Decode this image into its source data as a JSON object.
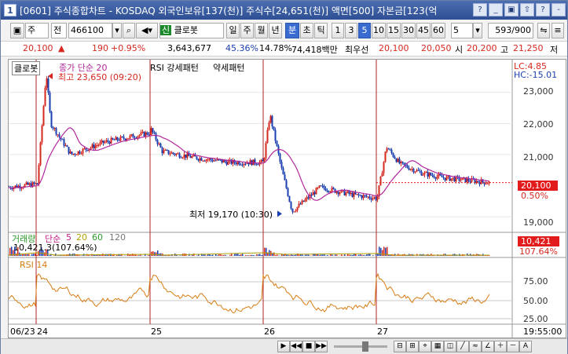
{
  "title": {
    "text": "[0601] 주식종합차트 - KOSDAQ 외국인보유[137(천)] 주식수[24,651(천)] 액면[500] 자본금[123(억",
    "icon": "1",
    "buttons": [
      "?",
      "_",
      "▣",
      "⇧",
      "?",
      "-"
    ]
  },
  "toolbar": {
    "mode": "주",
    "mode2": "전",
    "code": "466100",
    "name": "클로봇",
    "name_prefix": "신",
    "periods": [
      "일",
      "주",
      "월",
      "년",
      "분",
      "초",
      "틱"
    ],
    "active_period": "분",
    "intervals": [
      "1",
      "3",
      "5",
      "10",
      "15",
      "30",
      "45",
      "60"
    ],
    "active_interval": "5",
    "interval_select": "5",
    "page_count": "593/900"
  },
  "quote": {
    "price": "20,100",
    "change": "190",
    "change_pct": "+0.95%",
    "volume": "3,643,677",
    "vol_pct": "45.36%",
    "turnover": "14.78%",
    "amount": "74,418백만",
    "bid_label": "최우선",
    "bid": "20,100",
    "ask": "20,050",
    "open_label": "시",
    "open": "20,200",
    "high_label": "고",
    "high": "21,250",
    "low_label": "저"
  },
  "legend": {
    "name": "클로봇",
    "ma": "종가 단순 20",
    "rsi_pattern": "RSI 강세패턴",
    "rsi_weak": "약세패턴",
    "lc": "LC:4.85",
    "hc": "HC:-15.01",
    "vol_title": "거래량",
    "vol_ma_label": "단순",
    "vol_ma": [
      "5",
      "20",
      "60",
      "120"
    ],
    "vol_value": "10,421.3(107.64%)",
    "rsi_title": "RSI 14"
  },
  "annotations": {
    "max_label": "최고 23,650 (09:20)",
    "min_label": "최저 19,170 (10:30)"
  },
  "price_axis": [
    "23,000",
    "22,000",
    "21,000",
    "20,100",
    "0.50%",
    "19,000"
  ],
  "vol_axis": {
    "value": "10,421",
    "pct": "107.64%"
  },
  "rsi_axis": [
    "75.00",
    "50.00",
    "25.00"
  ],
  "time_axis": [
    "06/23",
    "24",
    "25",
    "26",
    "27"
  ],
  "clock": "19:55:00",
  "colors": {
    "up": "#d6281e",
    "down": "#1b3fb0",
    "ma": "#b0279c",
    "rsi": "#d87c12",
    "divider": "#b32020",
    "current": "#e21c1c"
  },
  "chart_data": {
    "type": "candlestick",
    "x_label": "5분봉",
    "y_range": [
      18700,
      23650
    ],
    "days": [
      {
        "date": "06/24",
        "open": 19900,
        "close": 21600,
        "high": 23650,
        "low": 19700
      },
      {
        "date": "06/25",
        "open": 21800,
        "close": 20550,
        "high": 21850,
        "low": 20450
      },
      {
        "date": "06/26",
        "open": 20800,
        "close": 19500,
        "high": 22300,
        "low": 19170
      },
      {
        "date": "06/27",
        "open": 20000,
        "close": 20100,
        "high": 21250,
        "low": 19800
      }
    ],
    "current_price": 20100,
    "high_marker": {
      "price": 23650,
      "time": "09:20"
    },
    "low_marker": {
      "price": 19170,
      "time": "10:30"
    }
  }
}
